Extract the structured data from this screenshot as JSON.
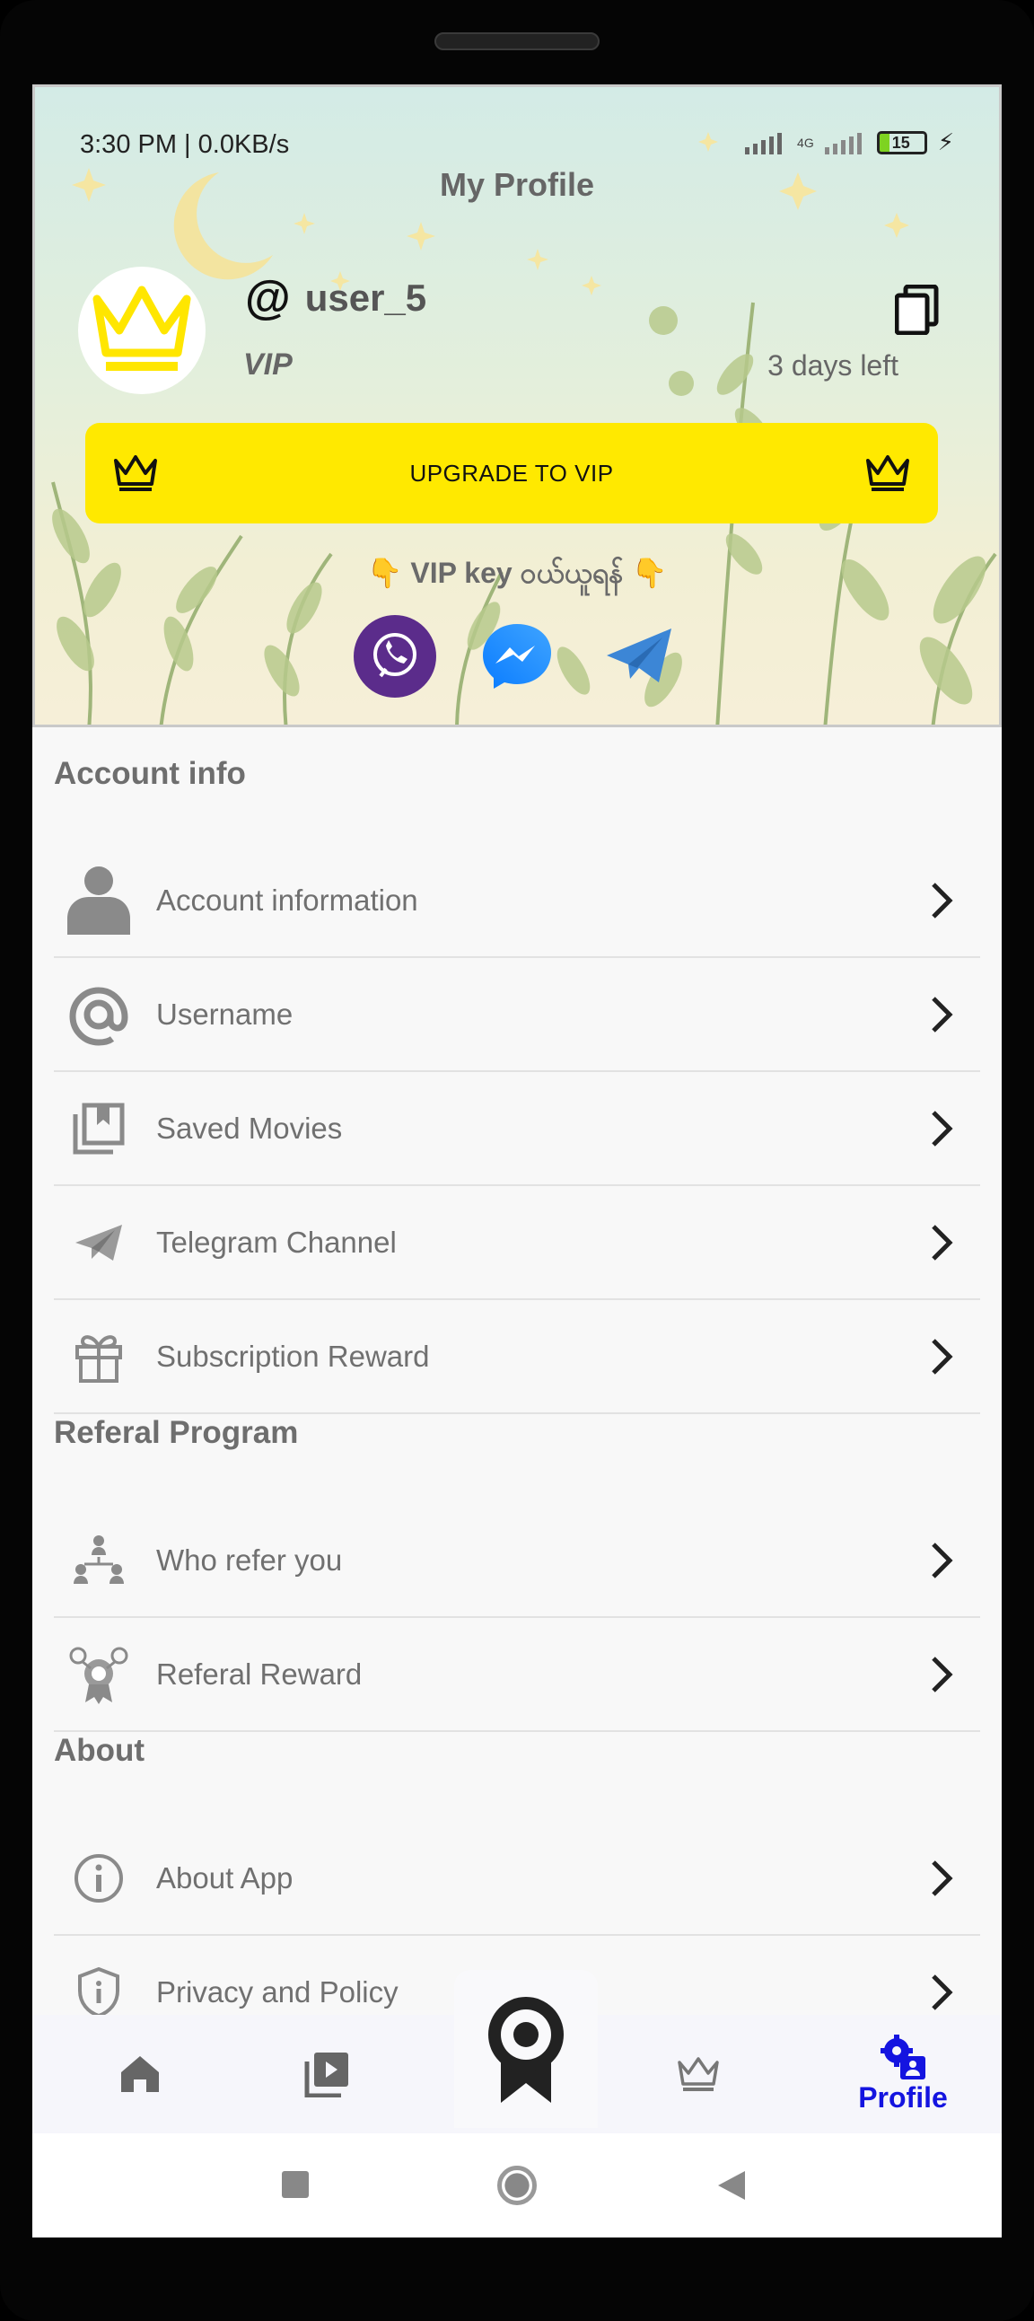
{
  "status_bar": {
    "time_speed": "3:30 PM | 0.0KB/s",
    "network": "4G",
    "battery": "15"
  },
  "header": {
    "title": "My Profile",
    "username": "user_5",
    "at_symbol": "@",
    "membership": "VIP",
    "days_left": "3 days left",
    "upgrade_label": "UPGRADE TO VIP",
    "vip_key_text": "👇 VIP key ဝယ်ယူရန် 👇"
  },
  "sections": {
    "account_info": "Account info",
    "referral": "Referal Program",
    "about": "About"
  },
  "rows": {
    "account_information": "Account information",
    "username": "Username",
    "saved_movies": "Saved Movies",
    "telegram_channel": "Telegram Channel",
    "subscription_reward": "Subscription Reward",
    "who_refer_you": "Who refer you",
    "referal_reward": "Referal Reward",
    "about_app": "About App",
    "privacy_policy": "Privacy and Policy"
  },
  "bottom_nav": {
    "profile_label": "Profile"
  },
  "colors": {
    "accent": "#1414e0",
    "upgrade_bg": "#ffe900",
    "crown": "#ffe600"
  },
  "icons": [
    "viber-icon",
    "messenger-icon",
    "telegram-icon",
    "crown-icon",
    "copy-icon",
    "home-icon",
    "play-library-icon",
    "badge-icon",
    "profile-settings-icon"
  ]
}
